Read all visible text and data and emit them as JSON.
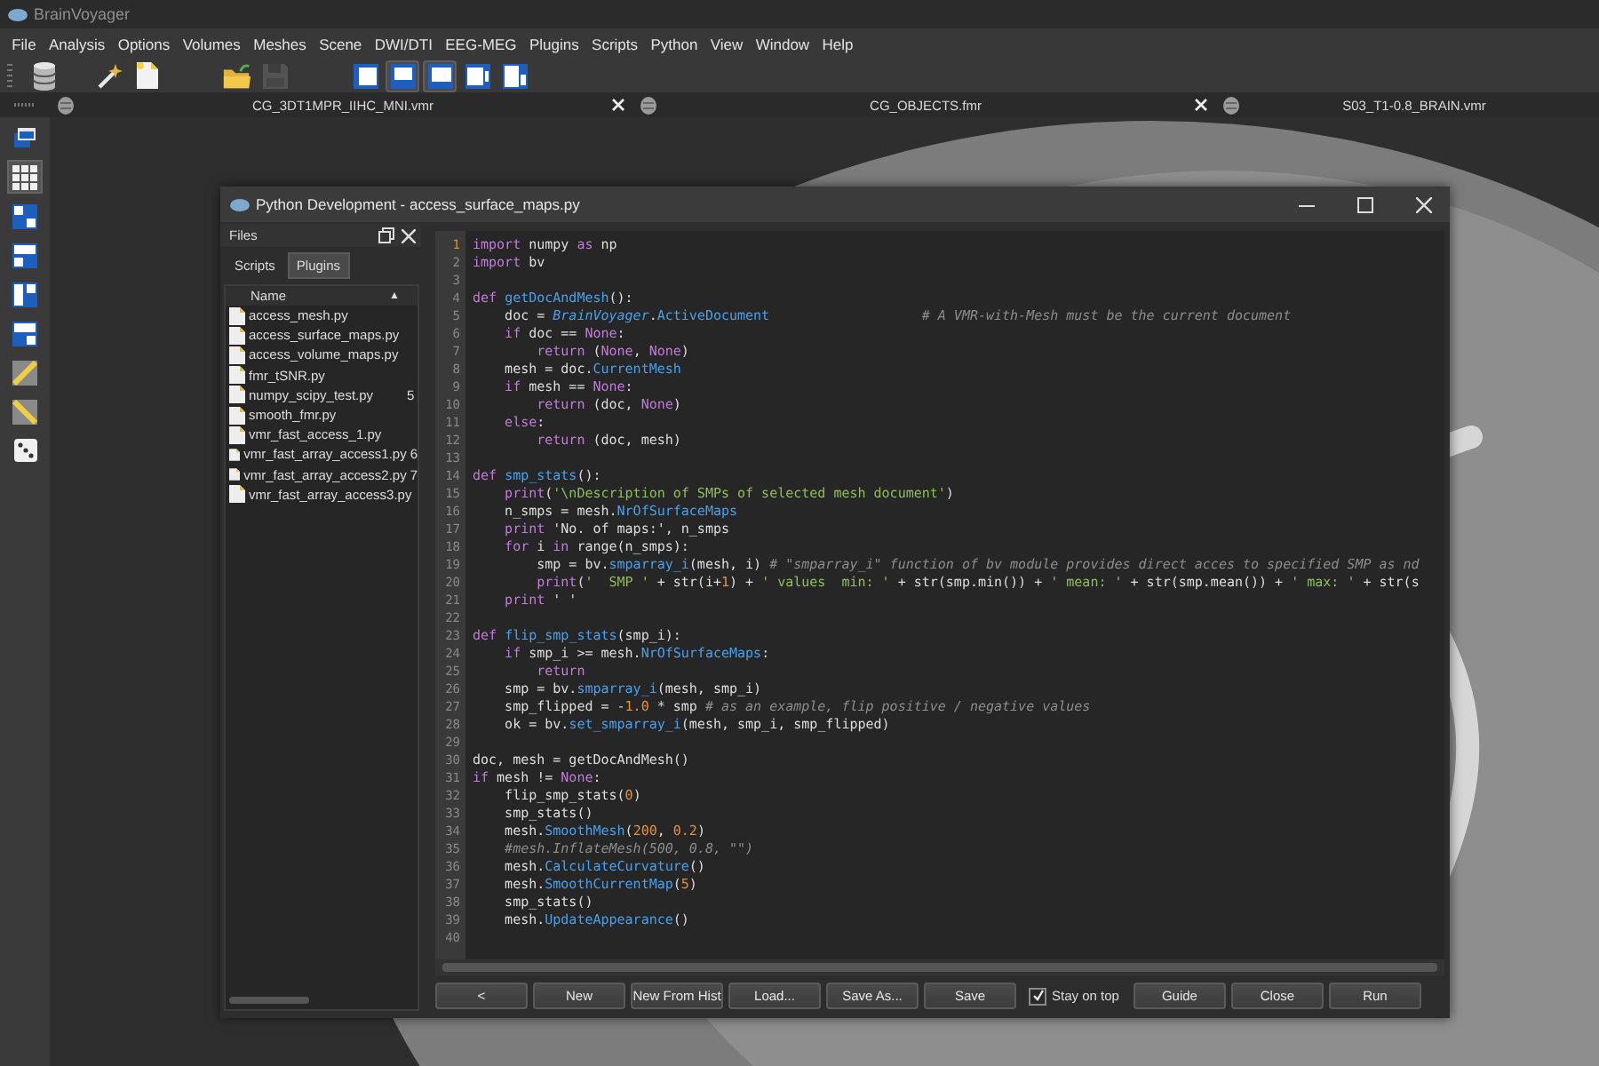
{
  "app": {
    "title": "BrainVoyager"
  },
  "menu": [
    "File",
    "Analysis",
    "Options",
    "Volumes",
    "Meshes",
    "Scene",
    "DWI/DTI",
    "EEG-MEG",
    "Plugins",
    "Scripts",
    "Python",
    "View",
    "Window",
    "Help"
  ],
  "toolbar": [
    {
      "kind": "database",
      "selected": false,
      "disabled": false
    },
    {
      "kind": "wand",
      "selected": false,
      "disabled": false
    },
    {
      "kind": "new-file",
      "selected": false,
      "disabled": false
    },
    {
      "kind": "folder",
      "selected": false,
      "disabled": false
    },
    {
      "kind": "save",
      "selected": false,
      "disabled": true
    },
    {
      "kind": "layout-1",
      "selected": false,
      "disabled": false
    },
    {
      "kind": "layout-2",
      "selected": true,
      "disabled": false
    },
    {
      "kind": "layout-3",
      "selected": true,
      "disabled": false
    },
    {
      "kind": "layout-4",
      "selected": false,
      "disabled": false
    },
    {
      "kind": "layout-5",
      "selected": false,
      "disabled": false
    }
  ],
  "document_tabs": [
    {
      "label": "CG_3DT1MPR_IIHC_MNI.vmr",
      "closable": true
    },
    {
      "label": "CG_OBJECTS.fmr",
      "closable": true
    },
    {
      "label": "S03_T1-0.8_BRAIN.vmr",
      "closable": false
    }
  ],
  "side_tools": [
    {
      "kind": "window",
      "selected": false
    },
    {
      "kind": "grid",
      "selected": true
    },
    {
      "kind": "split-a",
      "selected": false
    },
    {
      "kind": "split-b",
      "selected": false
    },
    {
      "kind": "split-c",
      "selected": false
    },
    {
      "kind": "split-d",
      "selected": false
    },
    {
      "kind": "ruler",
      "selected": false
    },
    {
      "kind": "ruler-alt",
      "selected": false
    },
    {
      "kind": "die",
      "selected": false
    }
  ],
  "python_window": {
    "title": "Python Development - access_surface_maps.py",
    "files": {
      "title": "Files",
      "tabs": [
        {
          "label": "Scripts",
          "selected": false
        },
        {
          "label": "Plugins",
          "selected": true
        }
      ],
      "column": "Name",
      "sort_indicator": "▲",
      "items": [
        {
          "name": "access_mesh.py"
        },
        {
          "name": "access_surface_maps.py"
        },
        {
          "name": "access_volume_maps.py"
        },
        {
          "name": "fmr_tSNR.py"
        },
        {
          "name": "numpy_scipy_test.py",
          "column_2": "5"
        },
        {
          "name": "smooth_fmr.py"
        },
        {
          "name": "vmr_fast_access_1.py"
        },
        {
          "name": "vmr_fast_array_access1.py",
          "column_2": "6"
        },
        {
          "name": "vmr_fast_array_access2.py",
          "column_2": "7"
        },
        {
          "name": "vmr_fast_array_access3.py"
        }
      ]
    },
    "editor": {
      "lines": [
        {
          "number": "1",
          "current": true,
          "tokens": [
            {
              "kind": "keyword",
              "text": "import"
            },
            {
              "kind": "plain",
              "text": " numpy "
            },
            {
              "kind": "keyword",
              "text": "as"
            },
            {
              "kind": "plain",
              "text": " np"
            }
          ]
        },
        {
          "number": "2",
          "current": false,
          "tokens": [
            {
              "kind": "keyword",
              "text": "import"
            },
            {
              "kind": "plain",
              "text": " bv"
            }
          ]
        },
        {
          "number": "3",
          "current": false
        },
        {
          "number": "4",
          "current": false,
          "tokens": [
            {
              "kind": "keyword",
              "text": "def "
            },
            {
              "kind": "name",
              "text": "getDocAndMesh"
            },
            {
              "kind": "plain",
              "text": "():"
            }
          ]
        },
        {
          "number": "5",
          "current": false,
          "tokens": [
            {
              "kind": "plain",
              "text": "    doc = "
            },
            {
              "kind": "class",
              "text": "BrainVoyager"
            },
            {
              "kind": "plain",
              "text": "."
            },
            {
              "kind": "name",
              "text": "ActiveDocument                   "
            },
            {
              "kind": "comment",
              "text": "# A VMR-with-Mesh must be the current document"
            }
          ]
        },
        {
          "number": "6",
          "current": false,
          "tokens": [
            {
              "kind": "keyword",
              "text": "    if"
            },
            {
              "kind": "plain",
              "text": " doc == "
            },
            {
              "kind": "keyword",
              "text": "None"
            },
            {
              "kind": "plain",
              "text": ":"
            }
          ]
        },
        {
          "number": "7",
          "current": false,
          "tokens": [
            {
              "kind": "keyword",
              "text": "        return"
            },
            {
              "kind": "plain",
              "text": " ("
            },
            {
              "kind": "keyword",
              "text": "None"
            },
            {
              "kind": "plain",
              "text": ", "
            },
            {
              "kind": "keyword",
              "text": "None"
            },
            {
              "kind": "plain",
              "text": ")"
            }
          ]
        },
        {
          "number": "8",
          "current": false,
          "tokens": [
            {
              "kind": "plain",
              "text": "    mesh = doc."
            },
            {
              "kind": "name",
              "text": "CurrentMesh"
            }
          ]
        },
        {
          "number": "9",
          "current": false,
          "tokens": [
            {
              "kind": "keyword",
              "text": "    if"
            },
            {
              "kind": "plain",
              "text": " mesh == "
            },
            {
              "kind": "keyword",
              "text": "None"
            },
            {
              "kind": "plain",
              "text": ":"
            }
          ]
        },
        {
          "number": "10",
          "current": false,
          "tokens": [
            {
              "kind": "keyword",
              "text": "        return"
            },
            {
              "kind": "plain",
              "text": " (doc, "
            },
            {
              "kind": "keyword",
              "text": "None"
            },
            {
              "kind": "plain",
              "text": ")"
            }
          ]
        },
        {
          "number": "11",
          "current": false,
          "tokens": [
            {
              "kind": "keyword",
              "text": "    else"
            },
            {
              "kind": "plain",
              "text": ":"
            }
          ]
        },
        {
          "number": "12",
          "current": false,
          "tokens": [
            {
              "kind": "keyword",
              "text": "        return"
            },
            {
              "kind": "plain",
              "text": " (doc, mesh)"
            }
          ]
        },
        {
          "number": "13",
          "current": false
        },
        {
          "number": "14",
          "current": false,
          "tokens": [
            {
              "kind": "keyword",
              "text": "def "
            },
            {
              "kind": "name",
              "text": "smp_stats"
            },
            {
              "kind": "plain",
              "text": "():"
            }
          ]
        },
        {
          "number": "15",
          "current": false,
          "tokens": [
            {
              "kind": "keyword",
              "text": "    print"
            },
            {
              "kind": "plain",
              "text": "("
            },
            {
              "kind": "string",
              "text": "'\\nDescription of SMPs of selected mesh document'"
            },
            {
              "kind": "plain",
              "text": ")"
            }
          ]
        },
        {
          "number": "16",
          "current": false,
          "tokens": [
            {
              "kind": "plain",
              "text": "    n_smps = mesh."
            },
            {
              "kind": "name",
              "text": "NrOfSurfaceMaps"
            }
          ]
        },
        {
          "number": "17",
          "current": false,
          "tokens": [
            {
              "kind": "keyword",
              "text": "    print"
            },
            {
              "kind": "plain",
              "text": " 'No. of maps:', n_smps"
            }
          ]
        },
        {
          "number": "18",
          "current": false,
          "tokens": [
            {
              "kind": "keyword",
              "text": "    for"
            },
            {
              "kind": "plain",
              "text": " i "
            },
            {
              "kind": "keyword",
              "text": "in"
            },
            {
              "kind": "plain",
              "text": " range(n_smps):"
            }
          ]
        },
        {
          "number": "19",
          "current": false,
          "tokens": [
            {
              "kind": "plain",
              "text": "        smp = bv."
            },
            {
              "kind": "name",
              "text": "smparray_i"
            },
            {
              "kind": "plain",
              "text": "(mesh, i) "
            },
            {
              "kind": "comment",
              "text": "# \"smparray_i\" function of bv module provides direct acces to specified SMP as nd"
            }
          ]
        },
        {
          "number": "20",
          "current": false,
          "tokens": [
            {
              "kind": "keyword",
              "text": "        print"
            },
            {
              "kind": "plain",
              "text": "("
            },
            {
              "kind": "string",
              "text": "'  SMP '"
            },
            {
              "kind": "plain",
              "text": " + str(i+"
            },
            {
              "kind": "number",
              "text": "1"
            },
            {
              "kind": "plain",
              "text": ") + "
            },
            {
              "kind": "string",
              "text": "' values  min: '"
            },
            {
              "kind": "plain",
              "text": " + str(smp.min()) + "
            },
            {
              "kind": "string",
              "text": "' mean: '"
            },
            {
              "kind": "plain",
              "text": " + str(smp.mean()) + "
            },
            {
              "kind": "string",
              "text": "' max: '"
            },
            {
              "kind": "plain",
              "text": " + str(s"
            }
          ]
        },
        {
          "number": "21",
          "current": false,
          "tokens": [
            {
              "kind": "keyword",
              "text": "    print"
            },
            {
              "kind": "plain",
              "text": " ' '"
            }
          ]
        },
        {
          "number": "22",
          "current": false
        },
        {
          "number": "23",
          "current": false,
          "tokens": [
            {
              "kind": "keyword",
              "text": "def "
            },
            {
              "kind": "name",
              "text": "flip_smp_stats"
            },
            {
              "kind": "plain",
              "text": "(smp_i):"
            }
          ]
        },
        {
          "number": "24",
          "current": false,
          "tokens": [
            {
              "kind": "keyword",
              "text": "    if"
            },
            {
              "kind": "plain",
              "text": " smp_i >= mesh."
            },
            {
              "kind": "name",
              "text": "NrOfSurfaceMaps"
            },
            {
              "kind": "plain",
              "text": ":"
            }
          ]
        },
        {
          "number": "25",
          "current": false,
          "tokens": [
            {
              "kind": "keyword",
              "text": "        return"
            }
          ]
        },
        {
          "number": "26",
          "current": false,
          "tokens": [
            {
              "kind": "plain",
              "text": "    smp = bv."
            },
            {
              "kind": "name",
              "text": "smparray_i"
            },
            {
              "kind": "plain",
              "text": "(mesh, smp_i)"
            }
          ]
        },
        {
          "number": "27",
          "current": false,
          "tokens": [
            {
              "kind": "plain",
              "text": "    smp_flipped = -"
            },
            {
              "kind": "number",
              "text": "1.0"
            },
            {
              "kind": "plain",
              "text": " * smp "
            },
            {
              "kind": "comment",
              "text": "# as an example, flip positive / negative values"
            }
          ]
        },
        {
          "number": "28",
          "current": false,
          "tokens": [
            {
              "kind": "plain",
              "text": "    ok = bv."
            },
            {
              "kind": "name",
              "text": "set_smparray_i"
            },
            {
              "kind": "plain",
              "text": "(mesh, smp_i, smp_flipped)"
            }
          ]
        },
        {
          "number": "29",
          "current": false
        },
        {
          "number": "30",
          "current": false,
          "tokens": [
            {
              "kind": "plain",
              "text": "doc, mesh = getDocAndMesh()"
            }
          ]
        },
        {
          "number": "31",
          "current": false,
          "tokens": [
            {
              "kind": "keyword",
              "text": "if"
            },
            {
              "kind": "plain",
              "text": " mesh != "
            },
            {
              "kind": "keyword",
              "text": "None"
            },
            {
              "kind": "plain",
              "text": ":"
            }
          ]
        },
        {
          "number": "32",
          "current": false,
          "tokens": [
            {
              "kind": "plain",
              "text": "    flip_smp_stats("
            },
            {
              "kind": "number",
              "text": "0"
            },
            {
              "kind": "plain",
              "text": ")"
            }
          ]
        },
        {
          "number": "33",
          "current": false,
          "tokens": [
            {
              "kind": "plain",
              "text": "    smp_stats()"
            }
          ]
        },
        {
          "number": "34",
          "current": false,
          "tokens": [
            {
              "kind": "plain",
              "text": "    mesh."
            },
            {
              "kind": "name",
              "text": "SmoothMesh"
            },
            {
              "kind": "plain",
              "text": "("
            },
            {
              "kind": "number",
              "text": "200"
            },
            {
              "kind": "plain",
              "text": ", "
            },
            {
              "kind": "number",
              "text": "0.2"
            },
            {
              "kind": "plain",
              "text": ")"
            }
          ]
        },
        {
          "number": "35",
          "current": false,
          "tokens": [
            {
              "kind": "comment",
              "text": "    #mesh.InflateMesh(500, 0.8, \"\")"
            }
          ]
        },
        {
          "number": "36",
          "current": false,
          "tokens": [
            {
              "kind": "plain",
              "text": "    mesh."
            },
            {
              "kind": "name",
              "text": "CalculateCurvature"
            },
            {
              "kind": "plain",
              "text": "()"
            }
          ]
        },
        {
          "number": "37",
          "current": false,
          "tokens": [
            {
              "kind": "plain",
              "text": "    mesh."
            },
            {
              "kind": "name",
              "text": "SmoothCurrentMap"
            },
            {
              "kind": "plain",
              "text": "("
            },
            {
              "kind": "number",
              "text": "5"
            },
            {
              "kind": "plain",
              "text": ")"
            }
          ]
        },
        {
          "number": "38",
          "current": false,
          "tokens": [
            {
              "kind": "plain",
              "text": "    smp_stats()"
            }
          ]
        },
        {
          "number": "39",
          "current": false,
          "tokens": [
            {
              "kind": "plain",
              "text": "    mesh."
            },
            {
              "kind": "name",
              "text": "UpdateAppearance"
            },
            {
              "kind": "plain",
              "text": "()"
            }
          ]
        },
        {
          "number": "40",
          "current": false
        }
      ]
    },
    "controls": [
      {
        "kind": "button",
        "label": "<"
      },
      {
        "kind": "button",
        "label": "New"
      },
      {
        "kind": "button",
        "label": "New From Hist"
      },
      {
        "kind": "button",
        "label": "Load..."
      },
      {
        "kind": "button",
        "label": "Save As..."
      },
      {
        "kind": "button",
        "label": "Save"
      },
      {
        "kind": "checkbox",
        "label": "Stay on top",
        "checked": true
      },
      {
        "kind": "button",
        "label": "Guide"
      },
      {
        "kind": "button",
        "label": "Close"
      },
      {
        "kind": "button",
        "label": "Run"
      }
    ]
  }
}
